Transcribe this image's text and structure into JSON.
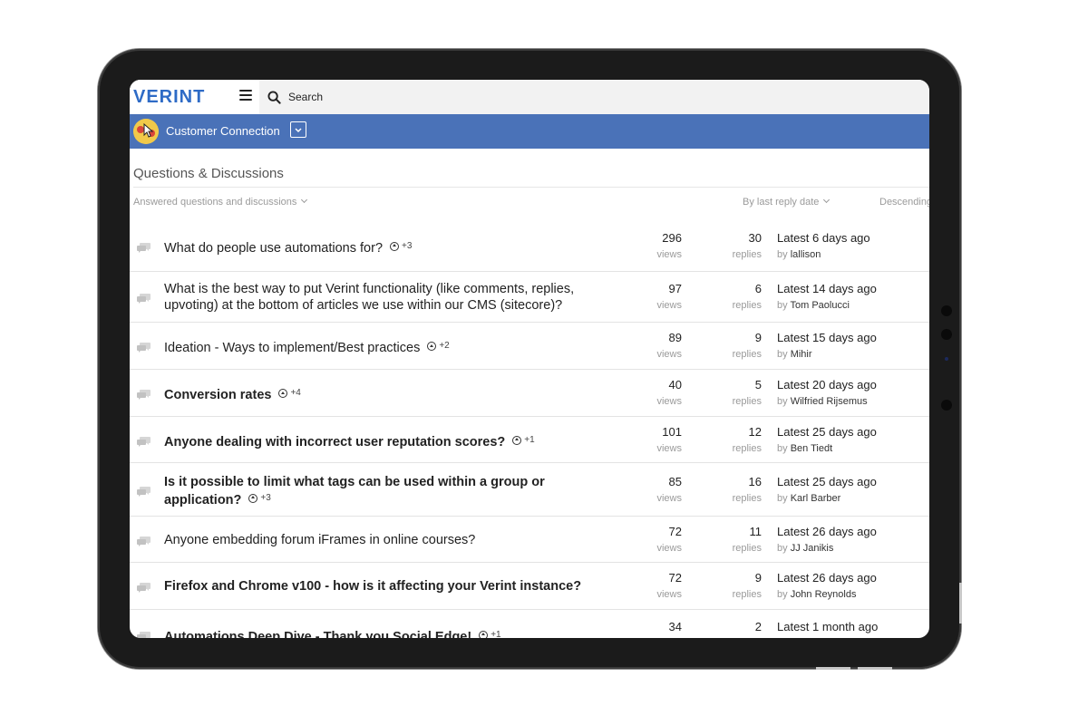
{
  "header": {
    "logo_text": "VERINT",
    "search_label": "Search"
  },
  "group": {
    "name": "Customer Connection"
  },
  "page": {
    "title": "Questions & Discussions"
  },
  "filters": {
    "type": "Answered questions and discussions",
    "sort_by": "By last reply date",
    "order": "Descending"
  },
  "labels": {
    "views": "views",
    "replies": "replies",
    "by": "by"
  },
  "threads": [
    {
      "title": "What do people use automations for?",
      "bold": false,
      "votes": "+3",
      "views": "296",
      "replies": "30",
      "latest": "Latest 6 days ago",
      "author": "lallison"
    },
    {
      "title": "What is the best way to put Verint functionality (like comments, replies, upvoting) at the bottom of articles we use within our CMS (sitecore)?",
      "bold": false,
      "votes": "",
      "views": "97",
      "replies": "6",
      "latest": "Latest 14 days ago",
      "author": "Tom Paolucci"
    },
    {
      "title": "Ideation - Ways to implement/Best practices",
      "bold": false,
      "votes": "+2",
      "views": "89",
      "replies": "9",
      "latest": "Latest 15 days ago",
      "author": "Mihir"
    },
    {
      "title": "Conversion rates",
      "bold": true,
      "votes": "+4",
      "views": "40",
      "replies": "5",
      "latest": "Latest 20 days ago",
      "author": "Wilfried Rijsemus"
    },
    {
      "title": "Anyone dealing with incorrect user reputation scores?",
      "bold": true,
      "votes": "+1",
      "views": "101",
      "replies": "12",
      "latest": "Latest 25 days ago",
      "author": "Ben Tiedt"
    },
    {
      "title": "Is it possible to limit what tags can be used within a group or application?",
      "bold": true,
      "votes": "+3",
      "views": "85",
      "replies": "16",
      "latest": "Latest 25 days ago",
      "author": "Karl Barber"
    },
    {
      "title": "Anyone embedding forum iFrames in online courses?",
      "bold": false,
      "votes": "",
      "views": "72",
      "replies": "11",
      "latest": "Latest 26 days ago",
      "author": "JJ Janikis"
    },
    {
      "title": "Firefox and Chrome v100 - how is it affecting your Verint instance?",
      "bold": true,
      "votes": "",
      "views": "72",
      "replies": "9",
      "latest": "Latest 26 days ago",
      "author": "John Reynolds"
    },
    {
      "title": "Automations Deep Dive - Thank you Social Edge!",
      "bold": true,
      "votes": "+1",
      "views": "34",
      "replies": "2",
      "latest": "Latest 1 month ago",
      "author": ""
    }
  ]
}
